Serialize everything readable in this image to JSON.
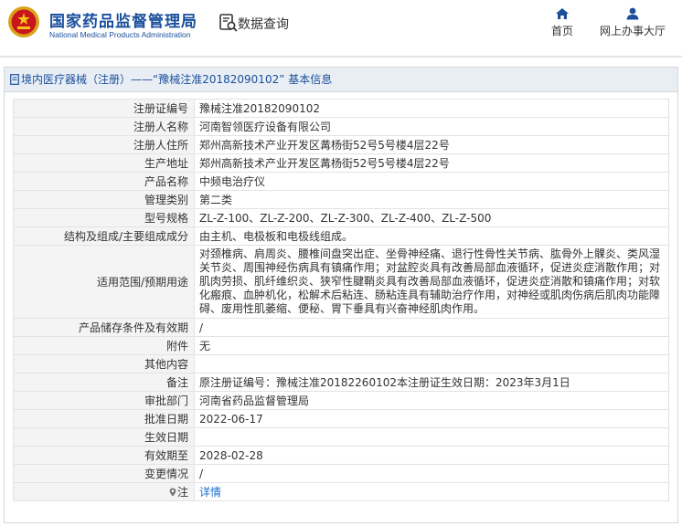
{
  "header": {
    "org_name_cn": "国家药品监督管理局",
    "org_name_en": "National Medical Products Administration",
    "query_title": "数据查询",
    "nav": [
      {
        "label": "首页",
        "icon": "home-icon"
      },
      {
        "label": "网上办事大厅",
        "icon": "user-icon"
      }
    ]
  },
  "panel": {
    "breadcrumb_link": "境内医疗器械（注册）",
    "breadcrumb_rest": "——“豫械注准20182090102” 基本信息"
  },
  "rows": [
    {
      "label": "注册证编号",
      "value": "豫械注准20182090102"
    },
    {
      "label": "注册人名称",
      "value": "河南智领医疗设备有限公司"
    },
    {
      "label": "注册人住所",
      "value": "郑州高新技术产业开发区冓杨街52号5号楼4层22号"
    },
    {
      "label": "生产地址",
      "value": "郑州高新技术产业开发区冓杨街52号5号楼4层22号"
    },
    {
      "label": "产品名称",
      "value": "中频电治疗仪"
    },
    {
      "label": "管理类别",
      "value": "第二类"
    },
    {
      "label": "型号规格",
      "value": "ZL-Z-100、ZL-Z-200、ZL-Z-300、ZL-Z-400、ZL-Z-500"
    },
    {
      "label": "结构及组成/主要组成成分",
      "value": "由主机、电极板和电极线组成。"
    },
    {
      "label": "适用范围/预期用途",
      "value": "对颈椎病、肩周炎、腰椎间盘突出症、坐骨神经痛、退行性骨性关节病、肱骨外上髁炎、类风湿关节炎、周围神经伤病具有镇痛作用；对盆腔炎具有改善局部血液循环，促进炎症消散作用；对肌肉劳损、肌纤维织炎、狭窄性腱鞘炎具有改善局部血液循环，促进炎症消散和镇痛作用；对软化瘢痕、血肿机化，松解术后粘连、肠粘连具有辅助治疗作用，对神经或肌肉伤病后肌肉功能障碍、废用性肌萎缩、便秘、胃下垂具有兴奋神经肌肉作用。"
    },
    {
      "label": "产品储存条件及有效期",
      "value": "/"
    },
    {
      "label": "附件",
      "value": "无"
    },
    {
      "label": "其他内容",
      "value": ""
    },
    {
      "label": "备注",
      "value": "原注册证编号：豫械注准20182260102本注册证生效日期：2023年3月1日"
    },
    {
      "label": "审批部门",
      "value": "河南省药品监督管理局"
    },
    {
      "label": "批准日期",
      "value": "2022-06-17"
    },
    {
      "label": "生效日期",
      "value": ""
    },
    {
      "label": "有效期至",
      "value": "2028-02-28"
    },
    {
      "label": "变更情况",
      "value": "/"
    },
    {
      "label": "注",
      "value": "详情"
    }
  ],
  "colors": {
    "brand_blue": "#1a4f9c",
    "link_blue": "#1a6ec9",
    "label_bg": "#f4f4f4",
    "title_bg": "#e9eef5"
  }
}
